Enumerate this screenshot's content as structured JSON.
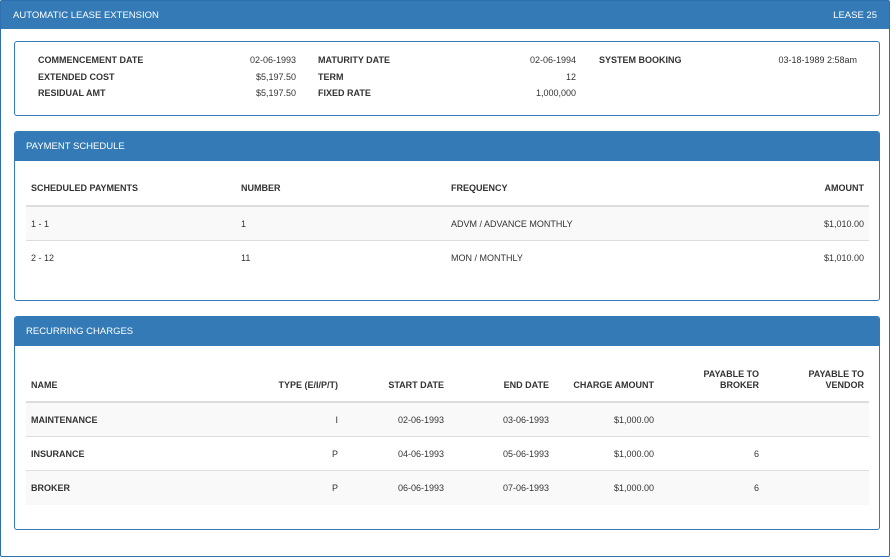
{
  "window": {
    "title": "AUTOMATIC LEASE EXTENSION",
    "lease": "LEASE 25"
  },
  "details": {
    "commencement_label": "COMMENCEMENT DATE",
    "commencement_value": "02-06-1993",
    "extended_cost_label": "EXTENDED COST",
    "extended_cost_value": "$5,197.50",
    "residual_label": "RESIDUAL AMT",
    "residual_value": "$5,197.50",
    "maturity_label": "MATURITY DATE",
    "maturity_value": "02-06-1994",
    "term_label": "TERM",
    "term_value": "12",
    "fixed_rate_label": "FIXED RATE",
    "fixed_rate_value": "1,000,000",
    "system_booking_label": "SYSTEM BOOKING",
    "system_booking_value": "03-18-1989 2:58am"
  },
  "payment_schedule": {
    "title": "PAYMENT SCHEDULE",
    "headers": [
      "SCHEDULED PAYMENTS",
      "NUMBER",
      "FREQUENCY",
      "AMOUNT"
    ],
    "rows": [
      [
        "1 - 1",
        "1",
        "ADVM / ADVANCE MONTHLY",
        "$1,010.00"
      ],
      [
        "2 - 12",
        "11",
        "MON / MONTHLY",
        "$1,010.00"
      ]
    ]
  },
  "recurring_charges": {
    "title": "RECURRING CHARGES",
    "headers": {
      "name": "NAME",
      "type": "TYPE (E/I/P/T)",
      "start": "START DATE",
      "end": "END DATE",
      "amount": "CHARGE AMOUNT",
      "broker_1": "PAYABLE TO",
      "broker_2": "BROKER",
      "vendor_1": "PAYABLE TO",
      "vendor_2": "VENDOR"
    },
    "rows": [
      [
        "MAINTENANCE",
        "I",
        "02-06-1993",
        "03-06-1993",
        "$1,000.00",
        "",
        ""
      ],
      [
        "INSURANCE",
        "P",
        "04-06-1993",
        "05-06-1993",
        "$1,000.00",
        "6",
        ""
      ],
      [
        "BROKER",
        "P",
        "06-06-1993",
        "07-06-1993",
        "$1,000.00",
        "6",
        ""
      ]
    ]
  }
}
